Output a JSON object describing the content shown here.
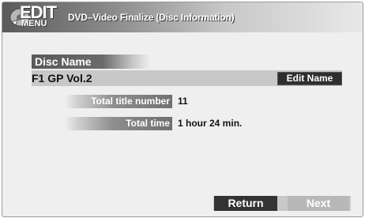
{
  "header": {
    "logo_edit": "EDIT",
    "logo_menu": "MENU",
    "title": "DVD–Video Finalize (Disc Information)"
  },
  "disc_name": {
    "label": "Disc Name",
    "value": "F1 GP Vol.2",
    "edit_button": "Edit Name"
  },
  "info": {
    "total_title_label": "Total title number",
    "total_title_value": "11",
    "total_time_label": "Total time",
    "total_time_value": "1 hour 24 min."
  },
  "buttons": {
    "return": "Return",
    "next": "Next"
  },
  "icons": {
    "logo": "edit-menu-disc-icon"
  },
  "colors": {
    "background": "#efefef",
    "selected_button": "#333333",
    "unselected_button": "#b8b8b8"
  }
}
